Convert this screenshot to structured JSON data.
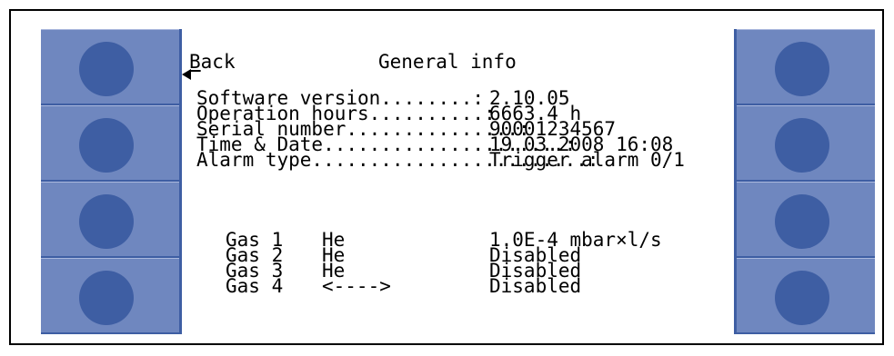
{
  "screen": {
    "back_label_first": "B",
    "back_label_rest": "ack",
    "title": "General info",
    "info": [
      {
        "label": "Software version........:",
        "value": "2.10.05"
      },
      {
        "label": "Operation hours..........:",
        "value": "6663.4 h"
      },
      {
        "label": "Serial number...............:",
        "value": "90001234567"
      },
      {
        "label": "Time & Date.....................:",
        "value": "19.03.2008 16:08"
      },
      {
        "label": "Alarm type........................:",
        "value": "Trigger alarm 0/1"
      }
    ],
    "gases": [
      {
        "name": "Gas 1",
        "gas": "He",
        "value": "1.0E-4 mbar×l/s"
      },
      {
        "name": "Gas 2",
        "gas": "He",
        "value": "Disabled"
      },
      {
        "name": "Gas 3",
        "gas": "He",
        "value": "Disabled"
      },
      {
        "name": "Gas 4",
        "gas": "<---->",
        "value": "Disabled"
      }
    ]
  },
  "colors": {
    "bezel": "#6f87bf",
    "knob": "#3e5ea3",
    "screen": "#ffffff"
  }
}
